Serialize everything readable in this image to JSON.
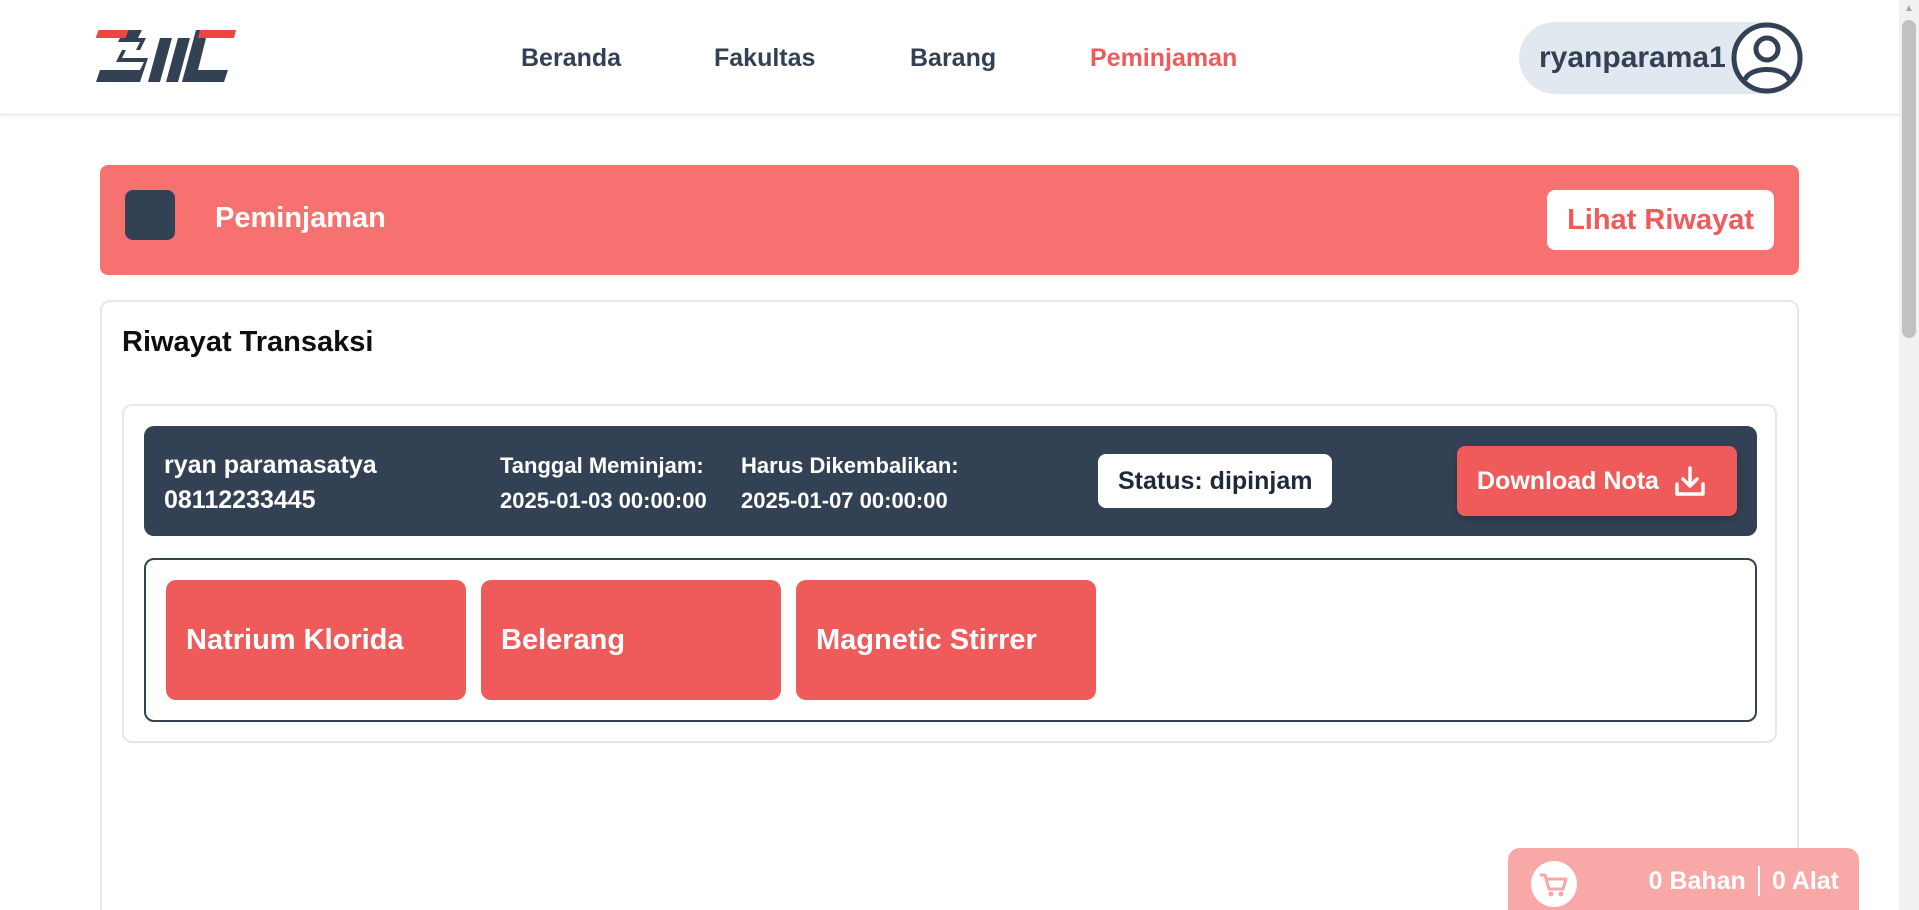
{
  "brand": {
    "logo_text": "SIIL",
    "accent_color": "#ef5a5a",
    "dark_color": "#334155"
  },
  "nav": {
    "items": [
      {
        "label": "Beranda",
        "active": false
      },
      {
        "label": "Fakultas",
        "active": false
      },
      {
        "label": "Barang",
        "active": false
      },
      {
        "label": "Peminjaman",
        "active": true
      }
    ]
  },
  "user": {
    "username": "ryanparama1",
    "avatar_icon": "user-circle-icon"
  },
  "banner": {
    "title": "Peminjaman",
    "history_button": "Lihat Riwayat"
  },
  "history": {
    "title": "Riwayat Transaksi",
    "transactions": [
      {
        "borrower_name": "ryan paramasatya",
        "phone": "08112233445",
        "borrow_label": "Tanggal Meminjam:",
        "borrow_date": "2025-01-03 00:00:00",
        "return_label": "Harus Dikembalikan:",
        "return_date": "2025-01-07 00:00:00",
        "status": "Status: dipinjam",
        "download_label": "Download Nota",
        "download_icon": "download-icon",
        "items": [
          "Natrium Klorida",
          "Belerang",
          "Magnetic Stirrer"
        ]
      }
    ]
  },
  "cart": {
    "icon": "cart-icon",
    "bahan": "0 Bahan",
    "alat": "0 Alat"
  }
}
